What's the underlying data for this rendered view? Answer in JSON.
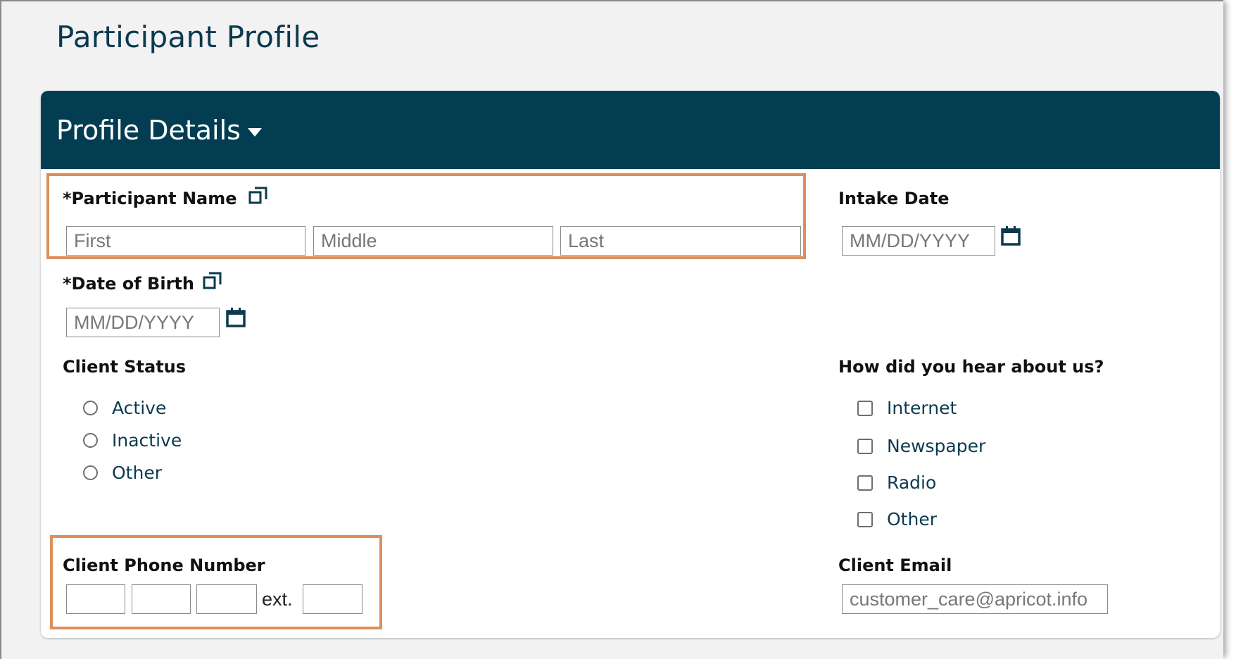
{
  "page": {
    "title": "Participant Profile"
  },
  "panel": {
    "title": "Profile Details"
  },
  "participant_name": {
    "label": "*Participant Name",
    "first_placeholder": "First",
    "middle_placeholder": "Middle",
    "last_placeholder": "Last"
  },
  "intake_date": {
    "label": "Intake Date",
    "placeholder": "MM/DD/YYYY"
  },
  "date_of_birth": {
    "label": "*Date of Birth",
    "placeholder": "MM/DD/YYYY"
  },
  "client_status": {
    "label": "Client Status",
    "options": [
      "Active",
      "Inactive",
      "Other"
    ]
  },
  "hear_about": {
    "label": "How did you hear about us?",
    "options": [
      "Internet",
      "Newspaper",
      "Radio",
      "Other"
    ]
  },
  "phone": {
    "label": "Client Phone Number",
    "ext_label": "ext."
  },
  "email": {
    "label": "Client Email",
    "value": "customer_care@apricot.info"
  },
  "colors": {
    "header_bg": "#023d51",
    "title_text": "#0b3a4f",
    "highlight": "#dc8f5c"
  },
  "icons": {
    "copy": "copy-icon",
    "calendar": "calendar-icon",
    "caret": "caret-down-icon"
  }
}
